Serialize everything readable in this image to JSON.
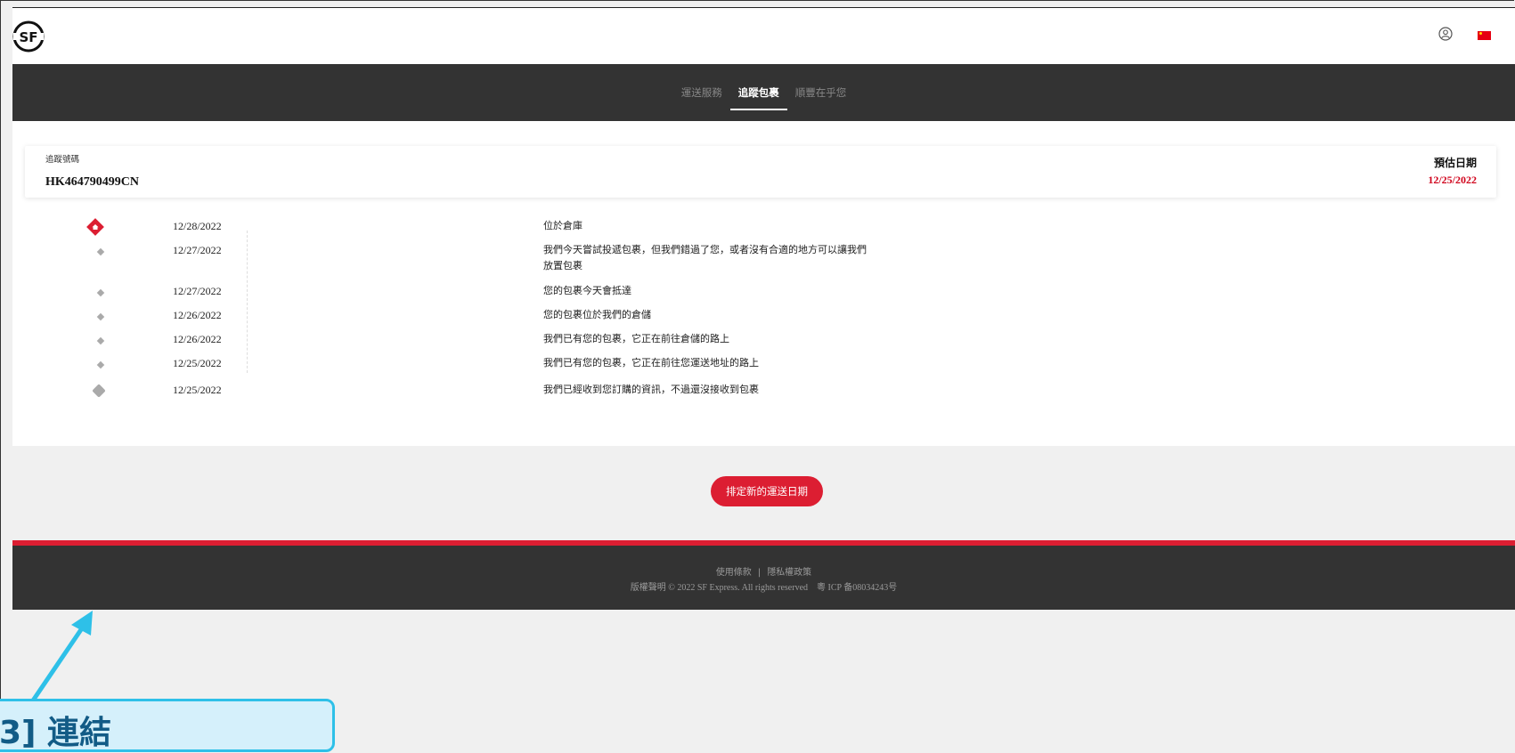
{
  "header": {
    "logo_text": "SF",
    "user_icon": "user-circle-icon",
    "flag_icon": "china-flag-icon"
  },
  "nav": {
    "tabs": [
      {
        "label": "運送服務",
        "active": false
      },
      {
        "label": "追蹤包裹",
        "active": true
      },
      {
        "label": "順豐在乎您",
        "active": false
      }
    ]
  },
  "tracking": {
    "label": "追蹤號碼",
    "number": "HK464790499CN",
    "estimated_label": "預估日期",
    "estimated_date": "12/25/2022"
  },
  "events": [
    {
      "date": "12/28/2022",
      "description": "位於倉庫",
      "marker": "home-icon"
    },
    {
      "date": "12/27/2022",
      "description": "我們今天嘗試投遞包裹，但我們錯過了您，或者沒有合適的地方可以讓我們放置包裹",
      "marker": "dot"
    },
    {
      "date": "12/27/2022",
      "description": "您的包裹今天會抵達",
      "marker": "dot"
    },
    {
      "date": "12/26/2022",
      "description": "您的包裹位於我們的倉儲",
      "marker": "dot"
    },
    {
      "date": "12/26/2022",
      "description": "我們已有您的包裹，它正在前往倉儲的路上",
      "marker": "dot"
    },
    {
      "date": "12/25/2022",
      "description": "我們已有您的包裹，它正在前往您運送地址的路上",
      "marker": "dot"
    },
    {
      "date": "12/25/2022",
      "description": "我們已經收到您訂購的資訊，不過還沒接收到包裹",
      "marker": "large-diamond"
    }
  ],
  "actions": {
    "reschedule_label": "排定新的運送日期"
  },
  "footer": {
    "terms": "使用條款",
    "separator": "|",
    "privacy": "隱私權政策",
    "copyright": "版權聲明 © 2022 SF Express. All rights reserved　粵 ICP 备08034243号"
  },
  "annotation": {
    "callout_text": "3] 連結"
  },
  "colors": {
    "brand_red": "#dc1e32",
    "nav_dark": "#333333",
    "callout_border": "#2ec0e8",
    "callout_fill": "#d5f0fb"
  }
}
